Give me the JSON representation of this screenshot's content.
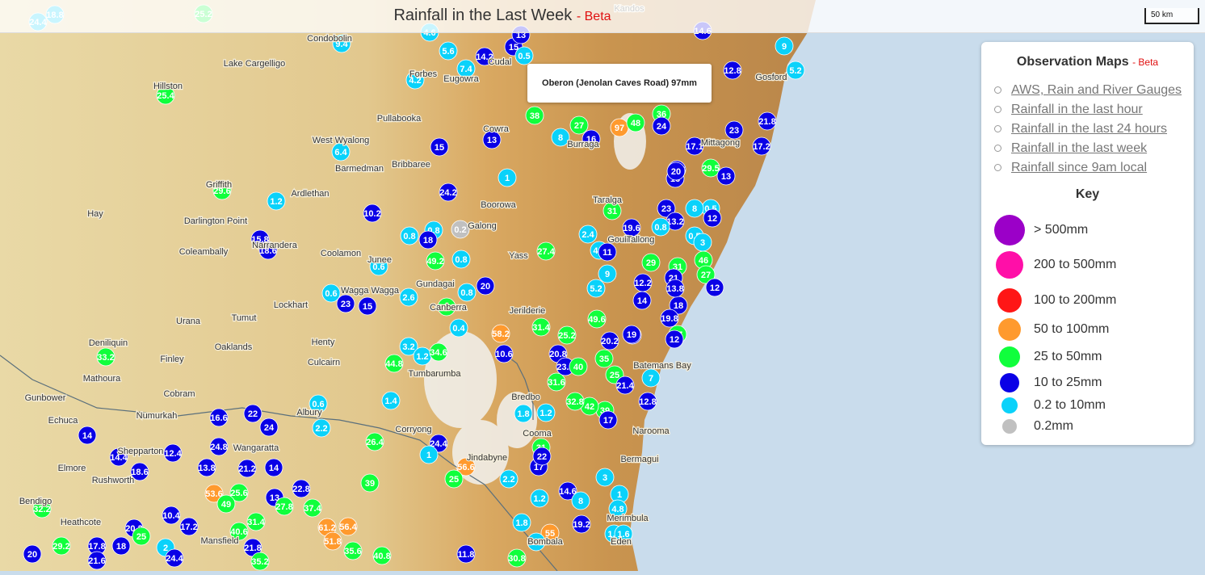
{
  "header": {
    "title": "Rainfall in the Last Week",
    "beta": "- Beta"
  },
  "scale_bar": "50 km",
  "tooltip": "Oberon (Jenolan Caves Road) 97mm",
  "panel": {
    "title": "Observation Maps",
    "beta": "- Beta",
    "links": [
      "AWS, Rain and River Gauges",
      "Rainfall in the last hour",
      "Rainfall in the last 24 hours",
      "Rainfall in the last week",
      "Rainfall since 9am local"
    ],
    "key_title": "Key",
    "key": [
      {
        "label": "> 500mm",
        "color": "#9b00c8"
      },
      {
        "label": "200 to 500mm",
        "color": "#ff0fa8"
      },
      {
        "label": "100 to 200mm",
        "color": "#ff1616"
      },
      {
        "label": "50 to 100mm",
        "color": "#ff9a2e"
      },
      {
        "label": "25 to 50mm",
        "color": "#10ff3c"
      },
      {
        "label": "10 to 25mm",
        "color": "#0a00e6"
      },
      {
        "label": "0.2 to 10mm",
        "color": "#0ad2fa"
      },
      {
        "label": "0.2mm",
        "color": "#c0c0c0"
      }
    ]
  },
  "places": [
    "Condobolin",
    "Lake Cargelligo",
    "Forbes",
    "Eugowra",
    "Cudal",
    "Hillston",
    "Pullabooka",
    "Cowra",
    "West Wyalong",
    "Barmedman",
    "Bribbaree",
    "Griffith",
    "Ardlethan",
    "Boorowa",
    "Hay",
    "Darlington Point",
    "Galong",
    "Narrandera",
    "Coleambally",
    "Coolamon",
    "Junee",
    "Yass",
    "Gundagai",
    "Wagga Wagga",
    "Lockhart",
    "Tumut",
    "Canberra",
    "Jerilderie",
    "Urana",
    "Deniliquin",
    "Finley",
    "Oaklands",
    "Henty",
    "Culcairn",
    "Tumbarumba",
    "Mathoura",
    "Cobram",
    "Gunbower",
    "Numurkah",
    "Albury",
    "Echuca",
    "Corryong",
    "Shepparton",
    "Wangaratta",
    "Jindabyne",
    "Elmore",
    "Rushworth",
    "Bendigo",
    "Heathcote",
    "Mansfield",
    "Eden",
    "Merimbula",
    "Bermagui",
    "Narooma",
    "Batemans Bay",
    "Bredbo",
    "Cooma",
    "Mittagong",
    "Gosford",
    "Kandos",
    "Taralga",
    "Goulburn",
    "Tallong",
    "Burraga",
    "Bombala"
  ],
  "stations": [
    {
      "v": "18.8",
      "c": "c"
    },
    {
      "v": "24.4",
      "c": "c"
    },
    {
      "v": "25.2",
      "c": "g"
    },
    {
      "v": "9.4",
      "c": "c"
    },
    {
      "v": "4.6",
      "c": "c"
    },
    {
      "v": "5.6",
      "c": "c"
    },
    {
      "v": "14.2",
      "c": "b"
    },
    {
      "v": "15",
      "c": "b"
    },
    {
      "v": "13",
      "c": "b"
    },
    {
      "v": "0.5",
      "c": "c"
    },
    {
      "v": "7.4",
      "c": "c"
    },
    {
      "v": "4.2",
      "c": "c"
    },
    {
      "v": "25.4",
      "c": "g"
    },
    {
      "v": "38",
      "c": "g"
    },
    {
      "v": "27",
      "c": "g"
    },
    {
      "v": "8",
      "c": "c"
    },
    {
      "v": "16",
      "c": "b"
    },
    {
      "v": "97",
      "c": "o"
    },
    {
      "v": "48",
      "c": "g"
    },
    {
      "v": "36",
      "c": "g"
    },
    {
      "v": "24",
      "c": "b"
    },
    {
      "v": "13",
      "c": "b"
    },
    {
      "v": "15",
      "c": "b"
    },
    {
      "v": "6.4",
      "c": "c"
    },
    {
      "v": "1",
      "c": "c"
    },
    {
      "v": "29.6",
      "c": "g"
    },
    {
      "v": "1.2",
      "c": "c"
    },
    {
      "v": "24.2",
      "c": "b"
    },
    {
      "v": "10.2",
      "c": "b"
    },
    {
      "v": "0.8",
      "c": "c"
    },
    {
      "v": "0.8",
      "c": "c"
    },
    {
      "v": "18",
      "c": "b"
    },
    {
      "v": "0.2",
      "c": "s"
    },
    {
      "v": "15.8",
      "c": "b"
    },
    {
      "v": "18.6",
      "c": "b"
    },
    {
      "v": "0.6",
      "c": "c"
    },
    {
      "v": "49.2",
      "c": "g"
    },
    {
      "v": "0.8",
      "c": "c"
    },
    {
      "v": "27.4",
      "c": "g"
    },
    {
      "v": "0.6",
      "c": "c"
    },
    {
      "v": "23",
      "c": "b"
    },
    {
      "v": "15",
      "c": "b"
    },
    {
      "v": "2.6",
      "c": "c"
    },
    {
      "v": "0.8",
      "c": "c"
    },
    {
      "v": "20",
      "c": "b"
    },
    {
      "v": "30.2",
      "c": "g"
    },
    {
      "v": "0.4",
      "c": "c"
    },
    {
      "v": "58.2",
      "c": "o"
    },
    {
      "v": "10.6",
      "c": "b"
    },
    {
      "v": "33.2",
      "c": "g"
    },
    {
      "v": "3.2",
      "c": "c"
    },
    {
      "v": "1.2",
      "c": "c"
    },
    {
      "v": "34.6",
      "c": "g"
    },
    {
      "v": "44.8",
      "c": "g"
    },
    {
      "v": "31.4",
      "c": "g"
    },
    {
      "v": "25.2",
      "c": "g"
    },
    {
      "v": "20.8",
      "c": "b"
    },
    {
      "v": "23.4",
      "c": "b"
    },
    {
      "v": "40",
      "c": "g"
    },
    {
      "v": "31.6",
      "c": "g"
    },
    {
      "v": "49.6",
      "c": "g"
    },
    {
      "v": "20.2",
      "c": "b"
    },
    {
      "v": "19",
      "c": "b"
    },
    {
      "v": "35",
      "c": "g"
    },
    {
      "v": "25",
      "c": "g"
    },
    {
      "v": "21.4",
      "c": "b"
    },
    {
      "v": "7",
      "c": "c"
    },
    {
      "v": "12.8",
      "c": "b"
    },
    {
      "v": "39",
      "c": "g"
    },
    {
      "v": "42",
      "c": "g"
    },
    {
      "v": "32.8",
      "c": "g"
    },
    {
      "v": "1.2",
      "c": "c"
    },
    {
      "v": "1.8",
      "c": "c"
    },
    {
      "v": "1.4",
      "c": "c"
    },
    {
      "v": "0.6",
      "c": "c"
    },
    {
      "v": "16.6",
      "c": "b"
    },
    {
      "v": "22",
      "c": "b"
    },
    {
      "v": "24",
      "c": "b"
    },
    {
      "v": "2.2",
      "c": "c"
    },
    {
      "v": "26.4",
      "c": "g"
    },
    {
      "v": "24.4",
      "c": "b"
    },
    {
      "v": "1",
      "c": "c"
    },
    {
      "v": "14",
      "c": "b"
    },
    {
      "v": "14.4",
      "c": "b"
    },
    {
      "v": "18.6",
      "c": "b"
    },
    {
      "v": "12.4",
      "c": "b"
    },
    {
      "v": "24.8",
      "c": "b"
    },
    {
      "v": "13.8",
      "c": "b"
    },
    {
      "v": "21.2",
      "c": "b"
    },
    {
      "v": "14",
      "c": "b"
    },
    {
      "v": "53.6",
      "c": "o"
    },
    {
      "v": "25.6",
      "c": "g"
    },
    {
      "v": "49",
      "c": "g"
    },
    {
      "v": "13",
      "c": "b"
    },
    {
      "v": "22.8",
      "c": "b"
    },
    {
      "v": "27.8",
      "c": "g"
    },
    {
      "v": "37.4",
      "c": "g"
    },
    {
      "v": "39",
      "c": "g"
    },
    {
      "v": "56.6",
      "c": "o"
    },
    {
      "v": "25",
      "c": "g"
    },
    {
      "v": "31",
      "c": "g"
    },
    {
      "v": "17",
      "c": "b"
    },
    {
      "v": "2.2",
      "c": "c"
    },
    {
      "v": "3",
      "c": "c"
    },
    {
      "v": "1.2",
      "c": "c"
    },
    {
      "v": "14.6",
      "c": "b"
    },
    {
      "v": "8",
      "c": "c"
    },
    {
      "v": "1",
      "c": "c"
    },
    {
      "v": "4.8",
      "c": "c"
    },
    {
      "v": "19.2",
      "c": "b"
    },
    {
      "v": "55",
      "c": "o"
    },
    {
      "v": "1.8",
      "c": "c"
    },
    {
      "v": "2.8",
      "c": "c"
    },
    {
      "v": "1.6",
      "c": "c"
    },
    {
      "v": "61.2",
      "c": "o"
    },
    {
      "v": "56.4",
      "c": "o"
    },
    {
      "v": "51.8",
      "c": "o"
    },
    {
      "v": "40.6",
      "c": "g"
    },
    {
      "v": "31.4",
      "c": "g"
    },
    {
      "v": "35.6",
      "c": "g"
    },
    {
      "v": "40.8",
      "c": "g"
    },
    {
      "v": "11.8",
      "c": "b"
    },
    {
      "v": "30.8",
      "c": "g"
    },
    {
      "v": "21.8",
      "c": "b"
    },
    {
      "v": "35.2",
      "c": "g"
    },
    {
      "v": "32.2",
      "c": "g"
    },
    {
      "v": "29.2",
      "c": "g"
    },
    {
      "v": "17.8",
      "c": "b"
    },
    {
      "v": "20",
      "c": "b"
    },
    {
      "v": "20.2",
      "c": "b"
    },
    {
      "v": "17.2",
      "c": "b"
    },
    {
      "v": "10.4",
      "c": "b"
    },
    {
      "v": "25",
      "c": "g"
    },
    {
      "v": "2",
      "c": "c"
    },
    {
      "v": "24.4",
      "c": "b"
    },
    {
      "v": "21.6",
      "c": "b"
    },
    {
      "v": "18",
      "c": "b"
    },
    {
      "v": "19",
      "c": "b"
    },
    {
      "v": "22",
      "c": "b"
    },
    {
      "v": "17",
      "c": "b"
    },
    {
      "v": "9",
      "c": "c"
    },
    {
      "v": "5.2",
      "c": "c"
    },
    {
      "v": "21.8",
      "c": "b"
    },
    {
      "v": "17.2",
      "c": "b"
    },
    {
      "v": "12.8",
      "c": "b"
    },
    {
      "v": "23",
      "c": "b"
    },
    {
      "v": "29.5",
      "c": "g"
    },
    {
      "v": "13",
      "c": "b"
    },
    {
      "v": "19.5",
      "c": "b"
    },
    {
      "v": "16",
      "c": "b"
    },
    {
      "v": "20",
      "c": "b"
    },
    {
      "v": "0.5",
      "c": "c"
    },
    {
      "v": "8",
      "c": "c"
    },
    {
      "v": "23",
      "c": "b"
    },
    {
      "v": "13.2",
      "c": "b"
    },
    {
      "v": "12",
      "c": "b"
    },
    {
      "v": "0.5",
      "c": "c"
    },
    {
      "v": "46",
      "c": "g"
    },
    {
      "v": "29",
      "c": "g"
    },
    {
      "v": "31",
      "c": "g"
    },
    {
      "v": "21",
      "c": "b"
    },
    {
      "v": "27",
      "c": "g"
    },
    {
      "v": "12",
      "c": "b"
    },
    {
      "v": "18",
      "c": "b"
    },
    {
      "v": "19.8",
      "c": "b"
    },
    {
      "v": "37",
      "c": "g"
    },
    {
      "v": "12",
      "c": "b"
    },
    {
      "v": "14",
      "c": "b"
    },
    {
      "v": "12.2",
      "c": "b"
    },
    {
      "v": "5.2",
      "c": "c"
    },
    {
      "v": "19.6",
      "c": "b"
    },
    {
      "v": "2.4",
      "c": "c"
    },
    {
      "v": "4.8",
      "c": "c"
    },
    {
      "v": "9",
      "c": "c"
    },
    {
      "v": "31",
      "c": "g"
    },
    {
      "v": "11",
      "c": "b"
    },
    {
      "v": "3",
      "c": "c"
    },
    {
      "v": "0.8",
      "c": "c"
    },
    {
      "v": "13.8",
      "c": "b"
    },
    {
      "v": "1.6",
      "c": "c"
    },
    {
      "v": "17.1",
      "c": "b"
    },
    {
      "v": "14.6",
      "c": "b"
    }
  ]
}
